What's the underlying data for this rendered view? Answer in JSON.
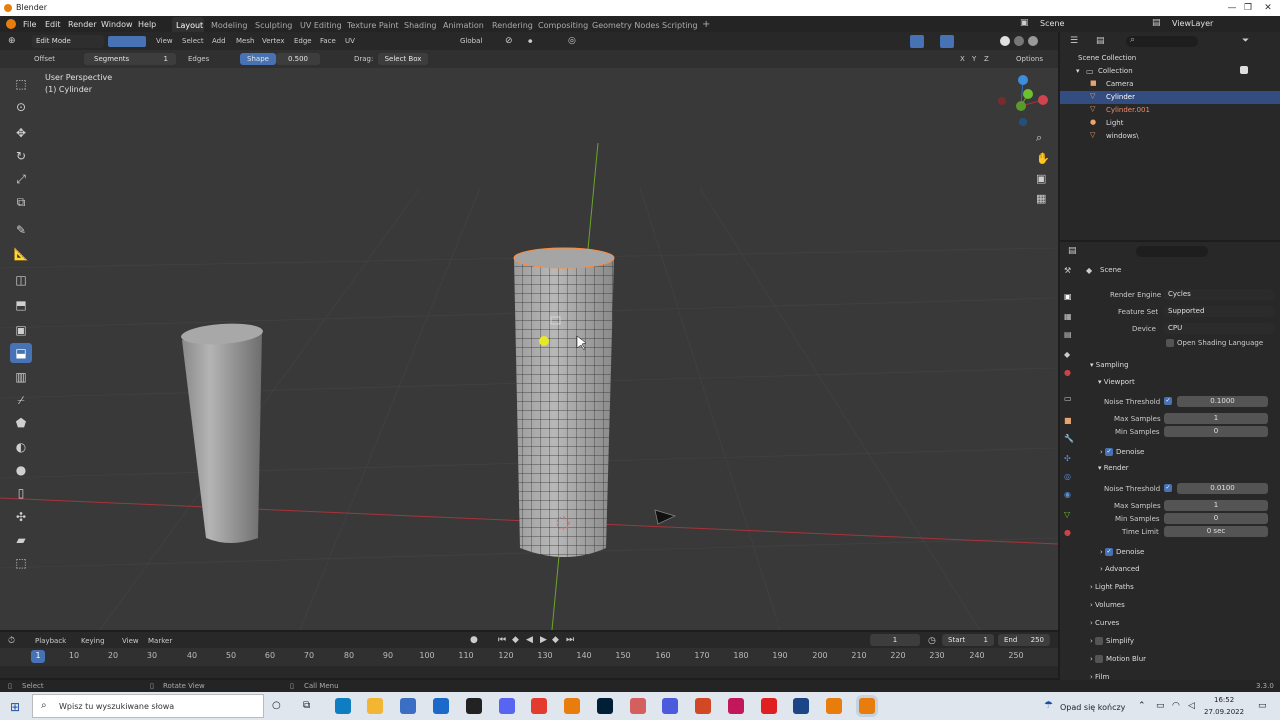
{
  "window": {
    "title": "Blender"
  },
  "menu": [
    "File",
    "Edit",
    "Render",
    "Window",
    "Help"
  ],
  "workspaces": [
    "Layout",
    "Modeling",
    "Sculpting",
    "UV Editing",
    "Texture Paint",
    "Shading",
    "Animation",
    "Rendering",
    "Compositing",
    "Geometry Nodes",
    "Scripting"
  ],
  "active_workspace": "Layout",
  "scene": {
    "label": "Scene",
    "view_layer": "ViewLayer"
  },
  "header": {
    "mode": "Edit Mode",
    "menus": [
      "View",
      "Select",
      "Add",
      "Mesh",
      "Vertex",
      "Edge",
      "Face",
      "UV"
    ],
    "transform_orientation": "Global",
    "options_label": "Options"
  },
  "tool_settings": {
    "offset_label": "Offset",
    "segments_label": "Segments",
    "segments_value": "1",
    "edges_label": "Edges",
    "shape_label": "Shape",
    "shape_value": "0.500",
    "drag_label": "Drag:",
    "drag_value": "Select Box"
  },
  "viewport": {
    "perspective": "User Perspective",
    "object": "(1) Cylinder",
    "axes": [
      "X",
      "Y",
      "Z"
    ]
  },
  "outliner": {
    "root": "Scene Collection",
    "collection": "Collection",
    "items": [
      "Camera",
      "Cylinder",
      "Cylinder.001",
      "Light",
      "windows\\"
    ],
    "selected": "Cylinder"
  },
  "properties": {
    "scene_label": "Scene",
    "render_engine_label": "Render Engine",
    "render_engine": "Cycles",
    "feature_set_label": "Feature Set",
    "feature_set": "Supported",
    "device_label": "Device",
    "device": "CPU",
    "osl_label": "Open Shading Language",
    "sampling": "Sampling",
    "viewport_label": "Viewport",
    "noise_threshold_label": "Noise Threshold",
    "viewport_noise_threshold": "0.1000",
    "max_samples_label": "Max Samples",
    "viewport_max_samples": "1",
    "min_samples_label": "Min Samples",
    "viewport_min_samples": "0",
    "denoise_label": "Denoise",
    "render_label": "Render",
    "render_noise_threshold": "0.0100",
    "render_max_samples": "1",
    "render_min_samples": "0",
    "time_limit_label": "Time Limit",
    "time_limit": "0 sec",
    "advanced_label": "Advanced",
    "sections": [
      "Light Paths",
      "Volumes",
      "Curves",
      "Simplify",
      "Motion Blur",
      "Film"
    ]
  },
  "timeline": {
    "menus": [
      "Playback",
      "Keying",
      "View",
      "Marker"
    ],
    "current_frame": "1",
    "start_label": "Start",
    "start": "1",
    "end_label": "End",
    "end": "250",
    "ticks": [
      "1",
      "10",
      "20",
      "30",
      "40",
      "50",
      "60",
      "70",
      "80",
      "90",
      "100",
      "110",
      "120",
      "130",
      "140",
      "150",
      "160",
      "170",
      "180",
      "190",
      "200",
      "210",
      "220",
      "230",
      "240",
      "250"
    ]
  },
  "status": {
    "select": "Select",
    "rotate": "Rotate View",
    "menu": "Call Menu",
    "version": "3.3.0"
  },
  "taskbar": {
    "search_placeholder": "Wpisz tu wyszukiwane słowa",
    "notification": "Opad się kończy",
    "time": "16:52",
    "date": "27.09.2022"
  },
  "colors": {
    "accent": "#4772b3",
    "selected_edge": "#ff8c3a",
    "x_axis": "#a6343c",
    "y_axis": "#6aa52a"
  }
}
